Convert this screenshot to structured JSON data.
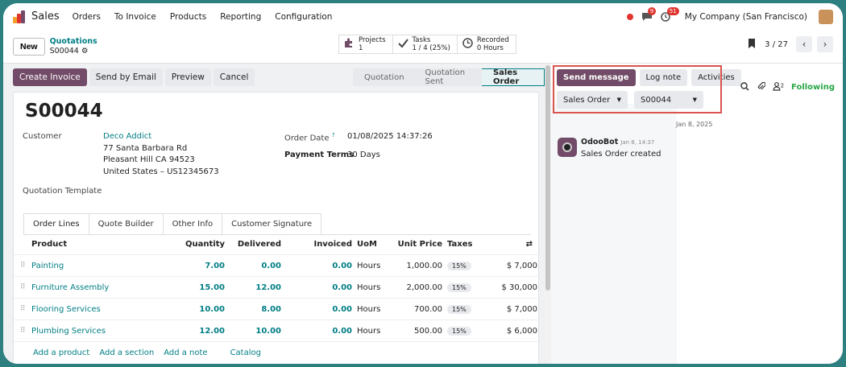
{
  "app": {
    "name": "Sales",
    "menu": [
      "Orders",
      "To Invoice",
      "Products",
      "Reporting",
      "Configuration"
    ],
    "chat_badge": "9",
    "activity_badge": "51",
    "company": "My Company (San Francisco)",
    "brand_color": "#714b67",
    "accent_color": "#017e84"
  },
  "control": {
    "new_label": "New",
    "breadcrumb_parent": "Quotations",
    "breadcrumb_current": "S00044",
    "smart_buttons": [
      {
        "icon": "puzzle-icon",
        "label": "Projects",
        "value": "1"
      },
      {
        "icon": "check-icon",
        "label": "Tasks",
        "value": "1 / 4 (25%)"
      },
      {
        "icon": "clock-icon",
        "label": "Recorded",
        "value": "0 Hours"
      }
    ],
    "pager": "3 / 27"
  },
  "form": {
    "actions": [
      "Create Invoice",
      "Send by Email",
      "Preview",
      "Cancel"
    ],
    "stages": [
      "Quotation",
      "Quotation Sent",
      "Sales Order"
    ],
    "active_stage": "Sales Order",
    "title": "S00044",
    "customer_label": "Customer",
    "customer_name": "Deco Addict",
    "address_line1": "77 Santa Barbara Rd",
    "address_line2": "Pleasant Hill CA 94523",
    "address_line3": "United States – US12345673",
    "order_date_label": "Order Date",
    "order_date_help": "?",
    "order_date": "01/08/2025 14:37:26",
    "payment_terms_label": "Payment Terms",
    "payment_terms": "30 Days",
    "quotation_template_label": "Quotation Template",
    "tabs": [
      "Order Lines",
      "Quote Builder",
      "Other Info",
      "Customer Signature"
    ],
    "columns": {
      "product": "Product",
      "quantity": "Quantity",
      "delivered": "Delivered",
      "invoiced": "Invoiced",
      "uom": "UoM",
      "unit_price": "Unit Price",
      "taxes": "Taxes"
    },
    "lines": [
      {
        "product": "Painting",
        "quantity": "7.00",
        "delivered": "0.00",
        "invoiced": "0.00",
        "uom": "Hours",
        "unit_price": "1,000.00",
        "tax": "15%",
        "subtotal": "$ 7,000"
      },
      {
        "product": "Furniture Assembly",
        "quantity": "15.00",
        "delivered": "12.00",
        "invoiced": "0.00",
        "uom": "Hours",
        "unit_price": "2,000.00",
        "tax": "15%",
        "subtotal": "$ 30,000"
      },
      {
        "product": "Flooring Services",
        "quantity": "10.00",
        "delivered": "8.00",
        "invoiced": "0.00",
        "uom": "Hours",
        "unit_price": "700.00",
        "tax": "15%",
        "subtotal": "$ 7,000"
      },
      {
        "product": "Plumbing Services",
        "quantity": "12.00",
        "delivered": "10.00",
        "invoiced": "0.00",
        "uom": "Hours",
        "unit_price": "500.00",
        "tax": "15%",
        "subtotal": "$ 6,000"
      }
    ],
    "add_links": [
      "Add a product",
      "Add a section",
      "Add a note",
      "Catalog"
    ]
  },
  "chatter": {
    "send_message": "Send message",
    "log_note": "Log note",
    "activities": "Activities",
    "select_model": "Sales Order",
    "select_record": "S00044",
    "followers_count": "2",
    "following": "Following",
    "date_separator": "Jan 8, 2025",
    "message_author": "OdooBot",
    "message_time": "Jan 8, 14:37",
    "message_body": "Sales Order created"
  }
}
